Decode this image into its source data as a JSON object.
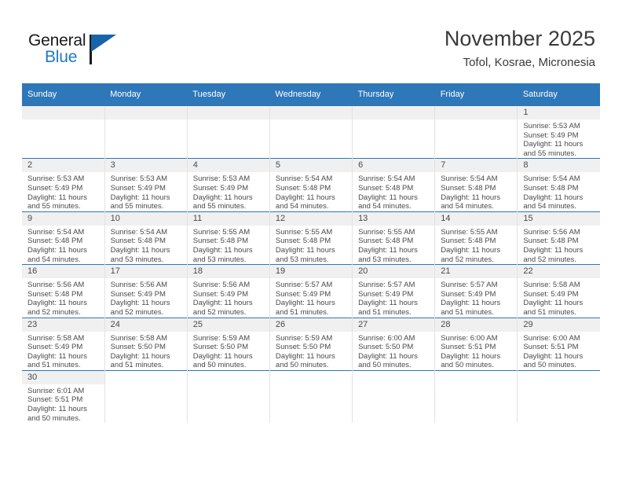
{
  "logo": {
    "word_one": "General",
    "word_two": "Blue",
    "brand_color": "#1f7ac0",
    "flag_color": "#1565a8"
  },
  "header": {
    "title": "November 2025",
    "subtitle": "Tofol, Kosrae, Micronesia"
  },
  "calendar": {
    "header_color": "#2e77b9",
    "weekday_headers": [
      "Sunday",
      "Monday",
      "Tuesday",
      "Wednesday",
      "Thursday",
      "Friday",
      "Saturday"
    ],
    "weeks": [
      [
        {
          "day": "",
          "empty": true
        },
        {
          "day": "",
          "empty": true
        },
        {
          "day": "",
          "empty": true
        },
        {
          "day": "",
          "empty": true
        },
        {
          "day": "",
          "empty": true
        },
        {
          "day": "",
          "empty": true
        },
        {
          "day": "1",
          "sunrise": "Sunrise: 5:53 AM",
          "sunset": "Sunset: 5:49 PM",
          "daylight_line1": "Daylight: 11 hours",
          "daylight_line2": "and 55 minutes."
        }
      ],
      [
        {
          "day": "2",
          "sunrise": "Sunrise: 5:53 AM",
          "sunset": "Sunset: 5:49 PM",
          "daylight_line1": "Daylight: 11 hours",
          "daylight_line2": "and 55 minutes."
        },
        {
          "day": "3",
          "sunrise": "Sunrise: 5:53 AM",
          "sunset": "Sunset: 5:49 PM",
          "daylight_line1": "Daylight: 11 hours",
          "daylight_line2": "and 55 minutes."
        },
        {
          "day": "4",
          "sunrise": "Sunrise: 5:53 AM",
          "sunset": "Sunset: 5:49 PM",
          "daylight_line1": "Daylight: 11 hours",
          "daylight_line2": "and 55 minutes."
        },
        {
          "day": "5",
          "sunrise": "Sunrise: 5:54 AM",
          "sunset": "Sunset: 5:48 PM",
          "daylight_line1": "Daylight: 11 hours",
          "daylight_line2": "and 54 minutes."
        },
        {
          "day": "6",
          "sunrise": "Sunrise: 5:54 AM",
          "sunset": "Sunset: 5:48 PM",
          "daylight_line1": "Daylight: 11 hours",
          "daylight_line2": "and 54 minutes."
        },
        {
          "day": "7",
          "sunrise": "Sunrise: 5:54 AM",
          "sunset": "Sunset: 5:48 PM",
          "daylight_line1": "Daylight: 11 hours",
          "daylight_line2": "and 54 minutes."
        },
        {
          "day": "8",
          "sunrise": "Sunrise: 5:54 AM",
          "sunset": "Sunset: 5:48 PM",
          "daylight_line1": "Daylight: 11 hours",
          "daylight_line2": "and 54 minutes."
        }
      ],
      [
        {
          "day": "9",
          "sunrise": "Sunrise: 5:54 AM",
          "sunset": "Sunset: 5:48 PM",
          "daylight_line1": "Daylight: 11 hours",
          "daylight_line2": "and 54 minutes."
        },
        {
          "day": "10",
          "sunrise": "Sunrise: 5:54 AM",
          "sunset": "Sunset: 5:48 PM",
          "daylight_line1": "Daylight: 11 hours",
          "daylight_line2": "and 53 minutes."
        },
        {
          "day": "11",
          "sunrise": "Sunrise: 5:55 AM",
          "sunset": "Sunset: 5:48 PM",
          "daylight_line1": "Daylight: 11 hours",
          "daylight_line2": "and 53 minutes."
        },
        {
          "day": "12",
          "sunrise": "Sunrise: 5:55 AM",
          "sunset": "Sunset: 5:48 PM",
          "daylight_line1": "Daylight: 11 hours",
          "daylight_line2": "and 53 minutes."
        },
        {
          "day": "13",
          "sunrise": "Sunrise: 5:55 AM",
          "sunset": "Sunset: 5:48 PM",
          "daylight_line1": "Daylight: 11 hours",
          "daylight_line2": "and 53 minutes."
        },
        {
          "day": "14",
          "sunrise": "Sunrise: 5:55 AM",
          "sunset": "Sunset: 5:48 PM",
          "daylight_line1": "Daylight: 11 hours",
          "daylight_line2": "and 52 minutes."
        },
        {
          "day": "15",
          "sunrise": "Sunrise: 5:56 AM",
          "sunset": "Sunset: 5:48 PM",
          "daylight_line1": "Daylight: 11 hours",
          "daylight_line2": "and 52 minutes."
        }
      ],
      [
        {
          "day": "16",
          "sunrise": "Sunrise: 5:56 AM",
          "sunset": "Sunset: 5:48 PM",
          "daylight_line1": "Daylight: 11 hours",
          "daylight_line2": "and 52 minutes."
        },
        {
          "day": "17",
          "sunrise": "Sunrise: 5:56 AM",
          "sunset": "Sunset: 5:49 PM",
          "daylight_line1": "Daylight: 11 hours",
          "daylight_line2": "and 52 minutes."
        },
        {
          "day": "18",
          "sunrise": "Sunrise: 5:56 AM",
          "sunset": "Sunset: 5:49 PM",
          "daylight_line1": "Daylight: 11 hours",
          "daylight_line2": "and 52 minutes."
        },
        {
          "day": "19",
          "sunrise": "Sunrise: 5:57 AM",
          "sunset": "Sunset: 5:49 PM",
          "daylight_line1": "Daylight: 11 hours",
          "daylight_line2": "and 51 minutes."
        },
        {
          "day": "20",
          "sunrise": "Sunrise: 5:57 AM",
          "sunset": "Sunset: 5:49 PM",
          "daylight_line1": "Daylight: 11 hours",
          "daylight_line2": "and 51 minutes."
        },
        {
          "day": "21",
          "sunrise": "Sunrise: 5:57 AM",
          "sunset": "Sunset: 5:49 PM",
          "daylight_line1": "Daylight: 11 hours",
          "daylight_line2": "and 51 minutes."
        },
        {
          "day": "22",
          "sunrise": "Sunrise: 5:58 AM",
          "sunset": "Sunset: 5:49 PM",
          "daylight_line1": "Daylight: 11 hours",
          "daylight_line2": "and 51 minutes."
        }
      ],
      [
        {
          "day": "23",
          "sunrise": "Sunrise: 5:58 AM",
          "sunset": "Sunset: 5:49 PM",
          "daylight_line1": "Daylight: 11 hours",
          "daylight_line2": "and 51 minutes."
        },
        {
          "day": "24",
          "sunrise": "Sunrise: 5:58 AM",
          "sunset": "Sunset: 5:50 PM",
          "daylight_line1": "Daylight: 11 hours",
          "daylight_line2": "and 51 minutes."
        },
        {
          "day": "25",
          "sunrise": "Sunrise: 5:59 AM",
          "sunset": "Sunset: 5:50 PM",
          "daylight_line1": "Daylight: 11 hours",
          "daylight_line2": "and 50 minutes."
        },
        {
          "day": "26",
          "sunrise": "Sunrise: 5:59 AM",
          "sunset": "Sunset: 5:50 PM",
          "daylight_line1": "Daylight: 11 hours",
          "daylight_line2": "and 50 minutes."
        },
        {
          "day": "27",
          "sunrise": "Sunrise: 6:00 AM",
          "sunset": "Sunset: 5:50 PM",
          "daylight_line1": "Daylight: 11 hours",
          "daylight_line2": "and 50 minutes."
        },
        {
          "day": "28",
          "sunrise": "Sunrise: 6:00 AM",
          "sunset": "Sunset: 5:51 PM",
          "daylight_line1": "Daylight: 11 hours",
          "daylight_line2": "and 50 minutes."
        },
        {
          "day": "29",
          "sunrise": "Sunrise: 6:00 AM",
          "sunset": "Sunset: 5:51 PM",
          "daylight_line1": "Daylight: 11 hours",
          "daylight_line2": "and 50 minutes."
        }
      ],
      [
        {
          "day": "30",
          "sunrise": "Sunrise: 6:01 AM",
          "sunset": "Sunset: 5:51 PM",
          "daylight_line1": "Daylight: 11 hours",
          "daylight_line2": "and 50 minutes."
        },
        {
          "day": "",
          "empty": true,
          "blank": true
        },
        {
          "day": "",
          "empty": true,
          "blank": true
        },
        {
          "day": "",
          "empty": true,
          "blank": true
        },
        {
          "day": "",
          "empty": true,
          "blank": true
        },
        {
          "day": "",
          "empty": true,
          "blank": true
        },
        {
          "day": "",
          "empty": true,
          "blank": true
        }
      ]
    ]
  }
}
